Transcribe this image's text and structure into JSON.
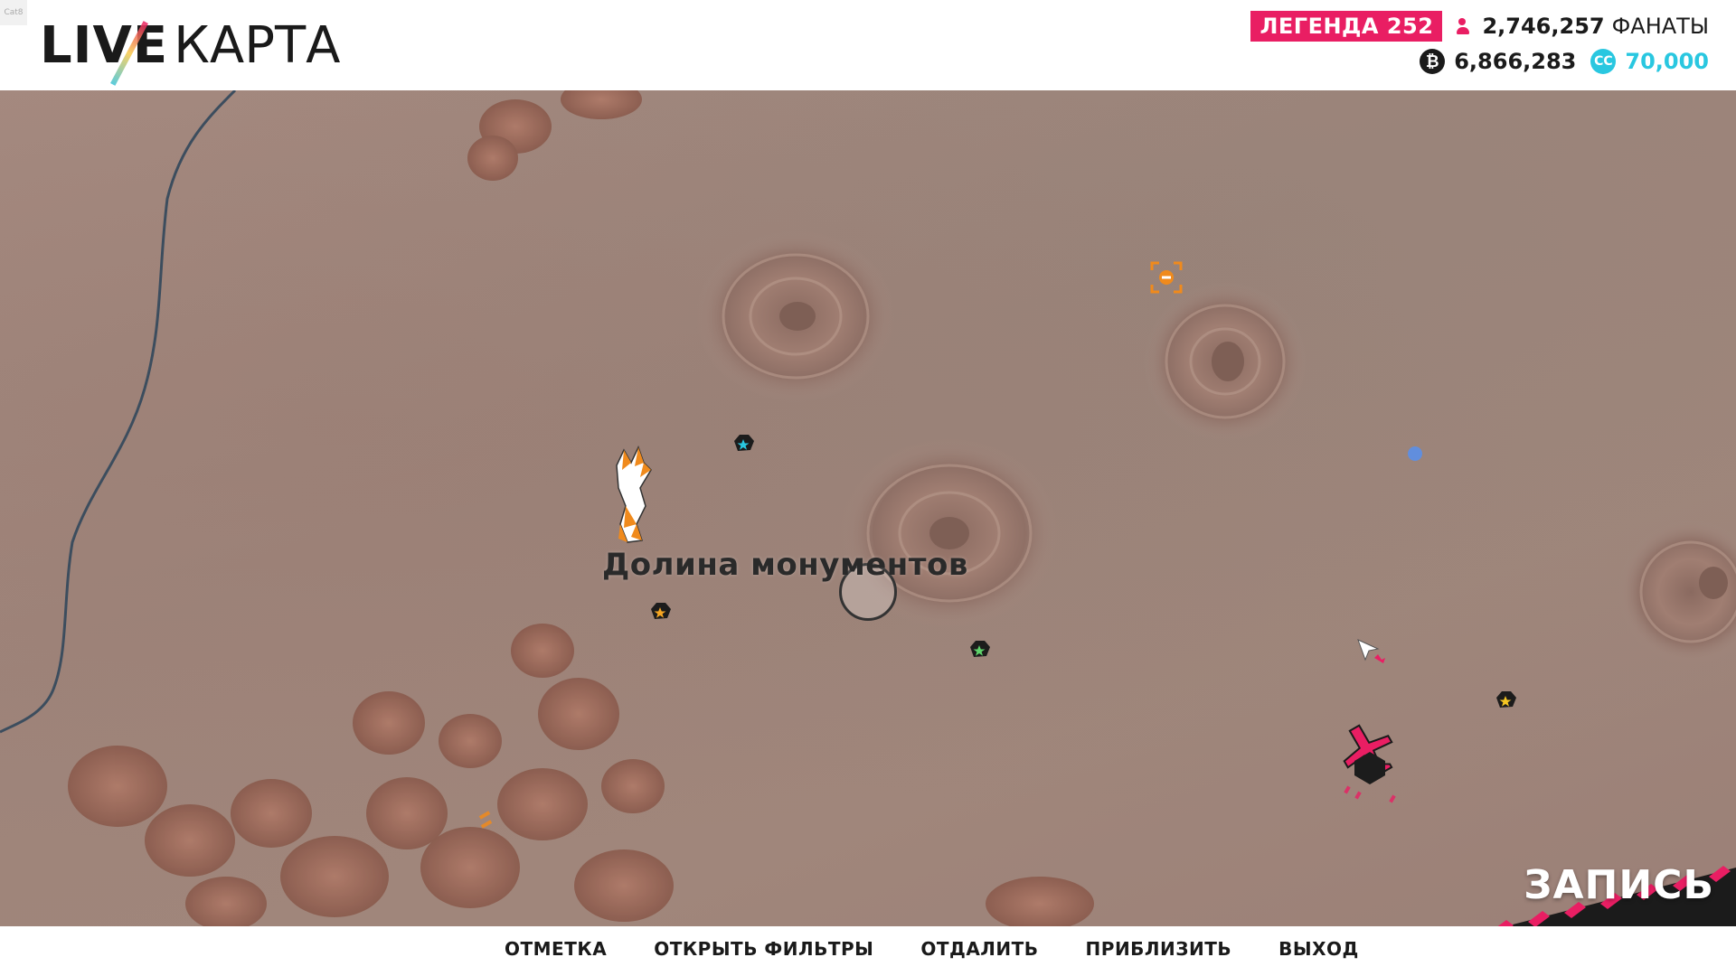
{
  "header": {
    "logo_live": "LIVE",
    "logo_karta": "КАРТА",
    "rank_label": "ЛЕГЕНДА 252",
    "fans_value": "2,746,257",
    "fans_word": "ФАНАТЫ",
    "credits_value": "6,866,283",
    "cc_value": "70,000",
    "corner_tag": "Cat8"
  },
  "map": {
    "region_label": "Долина монументов"
  },
  "menu": {
    "items": [
      "ОТМЕТКА",
      "ОТКРЫТЬ ФИЛЬТРЫ",
      "ОТДАЛИТЬ",
      "ПРИБЛИЗИТЬ",
      "ВЫХОД"
    ]
  },
  "record": {
    "label": "ЗАПИСЬ"
  },
  "icons": {
    "fans": "people-icon",
    "credits": "credits-coin-icon",
    "cc": "cc-coin-icon"
  },
  "colors": {
    "accent_pink": "#e91e63",
    "accent_cyan": "#29c7e0",
    "accent_orange": "#f08a1c"
  }
}
